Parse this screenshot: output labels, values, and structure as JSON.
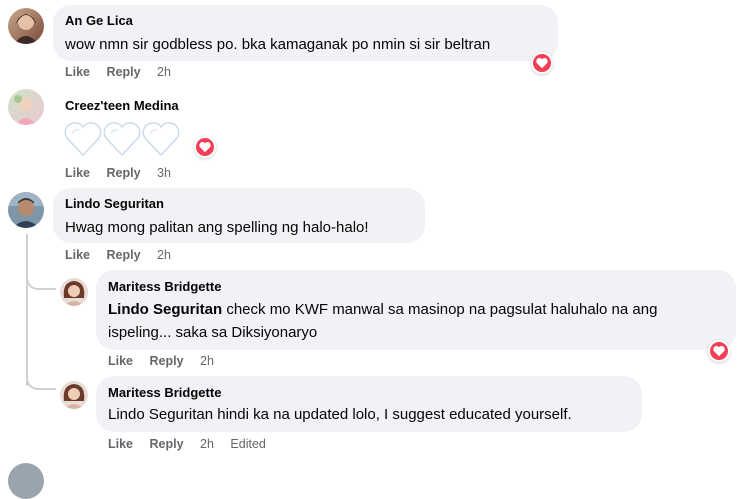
{
  "comments": [
    {
      "author": "An Ge Lica",
      "text": "wow nmn sir godbless po. bka kamaganak po nmin si sir beltran",
      "actions": {
        "like": "Like",
        "reply": "Reply",
        "time": "2h"
      }
    },
    {
      "author": "Creez'teen Medina",
      "text": "",
      "actions": {
        "like": "Like",
        "reply": "Reply",
        "time": "3h"
      }
    },
    {
      "author": "Lindo Seguritan",
      "text": "Hwag mong palitan ang spelling ng halo-halo!",
      "actions": {
        "like": "Like",
        "reply": "Reply",
        "time": "2h"
      }
    }
  ],
  "replies": [
    {
      "author": "Maritess Bridgette",
      "mention": "Lindo Seguritan",
      "line1_rest": " check mo KWF manwal sa masinop na pagsulat haluhalo na ang",
      "line2": "ispeling... saka sa Diksiyonaryo",
      "actions": {
        "like": "Like",
        "reply": "Reply",
        "time": "2h"
      }
    },
    {
      "author": "Maritess Bridgette",
      "text": "Lindo Seguritan hindi ka na updated lolo, I suggest educated yourself.",
      "actions": {
        "like": "Like",
        "reply": "Reply",
        "time": "2h",
        "edited": "Edited"
      }
    }
  ],
  "colors": {
    "bubble": "#f0f2f5",
    "action_text": "#65676b",
    "love_reaction": "#f33e58",
    "heart_emoji": "#dbeafe"
  },
  "icons": {
    "reaction": "love-reaction-icon",
    "emoji": "white-heart-emoji"
  }
}
